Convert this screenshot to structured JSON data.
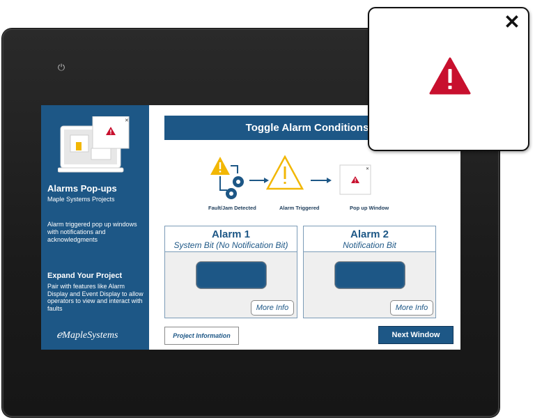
{
  "device": {
    "power_icon": "power-icon"
  },
  "sidebar": {
    "title": "Alarms Pop-ups",
    "subtitle": "Maple Systems Projects",
    "description": "Alarm triggered pop up windows with notifications and acknowledgments",
    "expand_title": "Expand Your Project",
    "expand_description": "Pair with features like Alarm Display and Event Display to allow operators to view and interact with faults",
    "logo": "MapleSystems"
  },
  "main": {
    "title": "Toggle Alarm Conditions",
    "flow": [
      {
        "label": "Fault/Jam Detected",
        "icon": "warning-gears-icon"
      },
      {
        "label": "Alarm Triggered",
        "icon": "warning-outline-icon"
      },
      {
        "label": "Pop up Window",
        "icon": "popup-window-icon"
      }
    ],
    "alarms": [
      {
        "title": "Alarm 1",
        "subtitle": "System Bit (No Notification Bit)",
        "more_info": "More Info"
      },
      {
        "title": "Alarm 2",
        "subtitle": "Notification Bit",
        "more_info": "More Info"
      }
    ],
    "project_info_label": "Project Information",
    "next_window_label": "Next Window"
  },
  "popup": {
    "close_icon": "close-icon",
    "warning_icon": "warning-icon"
  },
  "colors": {
    "brand_blue": "#1d5786",
    "warning_red": "#c8102e",
    "warning_yellow": "#f2b705"
  }
}
